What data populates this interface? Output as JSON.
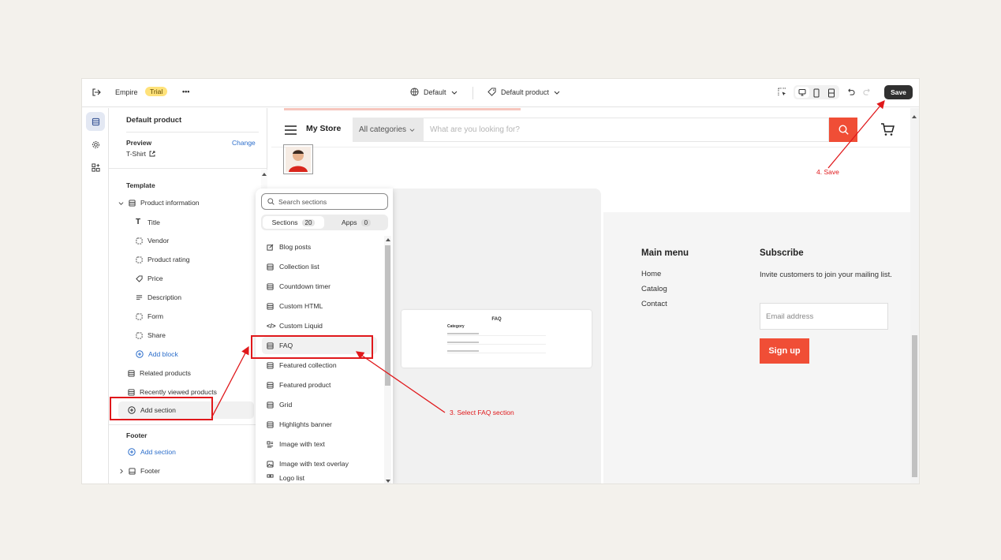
{
  "topbar": {
    "store_name": "Empire",
    "trial_badge": "Trial",
    "more_label": "•••",
    "theme_selector": "Default",
    "template_selector": "Default product",
    "save_label": "Save"
  },
  "panel": {
    "title": "Default product",
    "preview_label": "Preview",
    "change_label": "Change",
    "preview_item": "T-Shirt",
    "template_heading": "Template",
    "product_information": "Product information",
    "blocks": [
      {
        "label": "Title",
        "icon": "title-icon"
      },
      {
        "label": "Vendor",
        "icon": "block-icon"
      },
      {
        "label": "Product rating",
        "icon": "block-icon"
      },
      {
        "label": "Price",
        "icon": "price-tag-icon"
      },
      {
        "label": "Description",
        "icon": "text-lines-icon"
      },
      {
        "label": "Form",
        "icon": "block-icon"
      },
      {
        "label": "Share",
        "icon": "block-icon"
      }
    ],
    "add_block": "Add block",
    "related_products": "Related products",
    "recently_viewed": "Recently viewed products",
    "add_section": "Add section",
    "footer_heading": "Footer",
    "footer_add_section": "Add section",
    "footer_item": "Footer"
  },
  "picker": {
    "search_placeholder": "Search sections",
    "tab_sections": "Sections",
    "tab_sections_count": "20",
    "tab_apps": "Apps",
    "tab_apps_count": "0",
    "items": [
      "Blog posts",
      "Collection list",
      "Countdown timer",
      "Custom HTML",
      "Custom Liquid",
      "FAQ",
      "Featured collection",
      "Featured product",
      "Grid",
      "Highlights banner",
      "Image with text",
      "Image with text overlay",
      "Logo list"
    ],
    "selected": "FAQ",
    "preview_title": "FAQ",
    "preview_category": "Category"
  },
  "store": {
    "name": "My Store",
    "category_select": "All categories",
    "search_placeholder": "What are you looking for?",
    "main_menu_heading": "Main menu",
    "menu_links": [
      "Home",
      "Catalog",
      "Contact"
    ],
    "subscribe_heading": "Subscribe",
    "subscribe_text": "Invite customers to join your mailing list.",
    "email_placeholder": "Email address",
    "signup_label": "Sign up",
    "accent_color": "#f04e36"
  },
  "annotations": {
    "step3": "3. Select FAQ section",
    "step4": "4. Save",
    "color": "#e0181b"
  }
}
